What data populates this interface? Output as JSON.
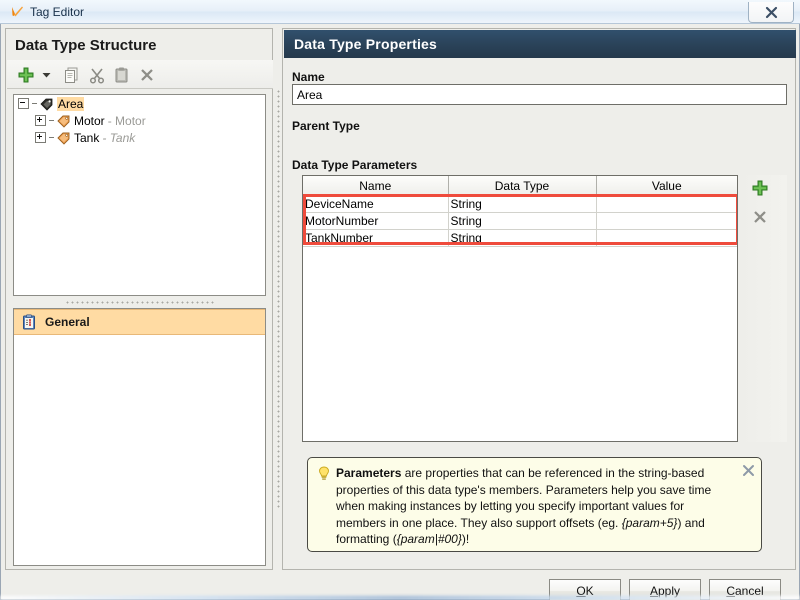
{
  "window": {
    "title": "Tag Editor",
    "icon": "tag-editor-icon",
    "close_label": "x"
  },
  "left_panel": {
    "title": "Data Type Structure",
    "toolbar": [
      {
        "name": "add-button",
        "icon": "plus-icon",
        "label": "Add"
      },
      {
        "name": "add-dropdown-button",
        "icon": "chevron-down-icon",
        "label": ""
      },
      {
        "name": "copy-button",
        "icon": "copy-icon",
        "label": "Copy"
      },
      {
        "name": "cut-button",
        "icon": "scissors-icon",
        "label": "Cut"
      },
      {
        "name": "paste-button",
        "icon": "clipboard-icon",
        "label": "Paste"
      },
      {
        "name": "delete-button",
        "icon": "delete-x-icon",
        "label": "Delete"
      }
    ],
    "tree": [
      {
        "label": "Area",
        "type": "",
        "expanded": true,
        "selected": true,
        "level": 0,
        "icon": "tag-dark-icon"
      },
      {
        "label": "Motor",
        "type": "Motor",
        "expanded": false,
        "selected": false,
        "level": 1,
        "icon": "tag-icon"
      },
      {
        "label": "Tank",
        "type": "Tank",
        "expanded": false,
        "selected": false,
        "level": 1,
        "icon": "tag-icon"
      }
    ],
    "categories": [
      {
        "label": "General",
        "icon": "clipboard-properties-icon",
        "selected": true
      }
    ]
  },
  "right_panel": {
    "header": "Data Type Properties",
    "name_label": "Name",
    "name_value": "Area",
    "name_placeholder": "",
    "parent_type_label": "Parent Type",
    "parent_type_value": "",
    "parameters_label": "Data Type Parameters",
    "table": {
      "columns": [
        "Name",
        "Data Type",
        "Value"
      ],
      "rows": [
        [
          "DeviceName",
          "String",
          ""
        ],
        [
          "MotorNumber",
          "String",
          ""
        ],
        [
          "TankNumber",
          "String",
          ""
        ]
      ],
      "highlight_color": "#ef4b3c"
    },
    "table_buttons": [
      {
        "name": "add-parameter-button",
        "icon": "plus-icon",
        "label": "Add parameter"
      },
      {
        "name": "remove-parameter-button",
        "icon": "delete-x-icon",
        "label": "Remove parameter"
      }
    ],
    "tip": {
      "icon": "lightbulb-icon",
      "close_icon": "close-icon",
      "title": "Parameters",
      "body_1": " are properties that can be referenced in the string-based properties of this data type's members. Parameters help you save time when making instances by letting you specify important values for members in one place. They also support offsets (eg. ",
      "code_1": "{param+5}",
      "body_2": ") and formatting (",
      "code_2": "{param|#00}",
      "body_3": ")!"
    }
  },
  "buttons": {
    "ok": {
      "before": "",
      "mnemonic": "O",
      "after": "K"
    },
    "apply": {
      "before": "",
      "mnemonic": "A",
      "after": "pply"
    },
    "cancel": {
      "before": "",
      "mnemonic": "C",
      "after": "ancel"
    }
  },
  "colors": {
    "header_navy": "#2a4258",
    "selection_orange": "#ffdba3",
    "highlight_red": "#ef4b3c",
    "tip_yellow": "#fdfde8",
    "dialog_gray": "#eeeeea"
  }
}
